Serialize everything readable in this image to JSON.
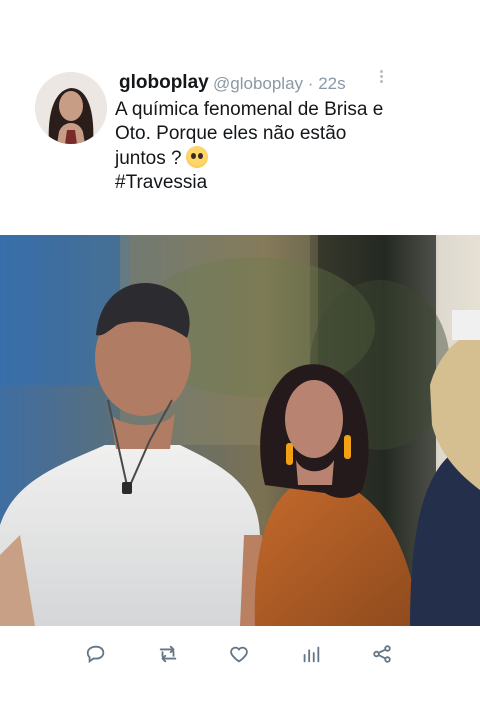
{
  "tweet": {
    "display_name": "globoplay",
    "handle": "@globoplay",
    "separator": "·",
    "time": "22s",
    "text_lines": [
      "A química fenomenal de Brisa e",
      "Oto. Porque eles não estão",
      "juntos ?"
    ],
    "hashtag": "#Travessia",
    "emoji_icon": "pleading-face-icon"
  },
  "actions": [
    "reply-icon",
    "retweet-icon",
    "like-icon",
    "views-icon",
    "share-icon"
  ],
  "colors": {
    "text": "#14171a",
    "muted": "#8b98a5",
    "icon": "#657786"
  }
}
